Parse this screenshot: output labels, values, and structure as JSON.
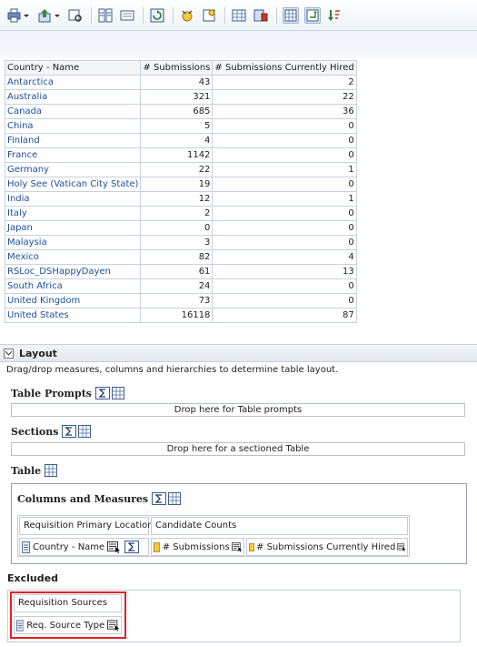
{
  "toolbar": {
    "icons": [
      "print-icon",
      "export-icon",
      "view-data-icon",
      "sort-icon",
      "format-icon",
      "refresh-icon",
      "new-group-icon",
      "new-calc-icon",
      "table-prompt-icon",
      "edit-view-icon",
      "table-layout-icon",
      "swap-icon",
      "sort-desc-icon"
    ]
  },
  "results": {
    "headers": [
      "Country - Name",
      "# Submissions",
      "# Submissions Currently Hired"
    ],
    "rows": [
      [
        "Antarctica",
        "43",
        "2"
      ],
      [
        "Australia",
        "321",
        "22"
      ],
      [
        "Canada",
        "685",
        "36"
      ],
      [
        "China",
        "5",
        "0"
      ],
      [
        "Finland",
        "4",
        "0"
      ],
      [
        "France",
        "1142",
        "0"
      ],
      [
        "Germany",
        "22",
        "1"
      ],
      [
        "Holy See (Vatican City State)",
        "19",
        "0"
      ],
      [
        "India",
        "12",
        "1"
      ],
      [
        "Italy",
        "2",
        "0"
      ],
      [
        "Japan",
        "0",
        "0"
      ],
      [
        "Malaysia",
        "3",
        "0"
      ],
      [
        "Mexico",
        "82",
        "4"
      ],
      [
        "RSLoc_DSHappyDayen",
        "61",
        "13"
      ],
      [
        "South Africa",
        "24",
        "0"
      ],
      [
        "United Kingdom",
        "73",
        "0"
      ],
      [
        "United States",
        "16118",
        "87"
      ]
    ]
  },
  "layout": {
    "title": "Layout",
    "description": "Drag/drop measures, columns and hierarchies to determine table layout.",
    "table_prompts": {
      "label": "Table Prompts",
      "drop": "Drop here for Table prompts"
    },
    "sections": {
      "label": "Sections",
      "drop": "Drop here for a sectioned Table"
    },
    "table": {
      "label": "Table"
    },
    "columns_measures": {
      "label": "Columns and Measures",
      "group1": "Requisition Primary Location",
      "group2": "Candidate Counts",
      "col1": "Country - Name",
      "col2": "# Submissions",
      "col3": "# Submissions Currently Hired"
    },
    "excluded": {
      "label": "Excluded",
      "group": "Requisition Sources",
      "col": "Req. Source Type"
    }
  },
  "colors": {
    "accent_border": "#e2202a",
    "link_text": "#1b4f99"
  }
}
